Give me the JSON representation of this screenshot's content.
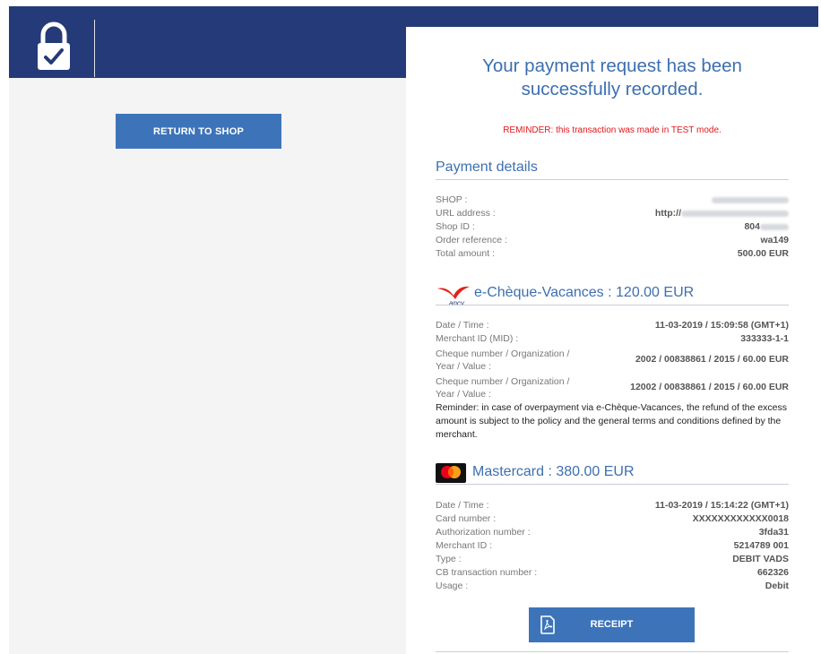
{
  "header": {
    "lock_icon": "lock-check-icon"
  },
  "left": {
    "return_label": "RETURN TO SHOP"
  },
  "confirmation": {
    "headline_line1": "Your payment request has been",
    "headline_line2": "successfully recorded.",
    "reminder": "REMINDER: this transaction was made in TEST mode."
  },
  "payment_details": {
    "title": "Payment details",
    "rows": [
      {
        "label": "SHOP :",
        "value": ""
      },
      {
        "label": "URL address :",
        "value": "http://"
      },
      {
        "label": "Shop ID :",
        "value": "804"
      },
      {
        "label": "Order reference :",
        "value": "wa149"
      },
      {
        "label": "Total amount :",
        "value": "500.00 EUR"
      }
    ]
  },
  "cheque": {
    "title": "e-Chèque-Vacances : 120.00 EUR",
    "logo_text": "ancv",
    "rows": [
      {
        "label": "Date / Time :",
        "value": "11-03-2019 / 15:09:58 (GMT+1)"
      },
      {
        "label": "Merchant ID (MID) :",
        "value": "333333-1-1"
      },
      {
        "label": "Cheque number / Organization / Year / Value :",
        "value": "2002 / 00838861 / 2015 / 60.00 EUR"
      },
      {
        "label": "Cheque number / Organization / Year / Value :",
        "value": "12002 / 00838861 / 2015 / 60.00 EUR"
      }
    ],
    "note": "Reminder: in case of overpayment via e-Chèque-Vacances, the refund of the excess amount is subject to the policy and the general terms and conditions defined by the merchant."
  },
  "mastercard": {
    "title": "Mastercard : 380.00 EUR",
    "logo_icon": "mastercard-logo-icon",
    "colors": {
      "red": "#eb001b",
      "orange": "#f79e1b",
      "yellow": "#ff5f00"
    },
    "rows": [
      {
        "label": "Date / Time :",
        "value": "11-03-2019 / 15:14:22 (GMT+1)"
      },
      {
        "label": "Card number :",
        "value": "XXXXXXXXXXXX0018"
      },
      {
        "label": "Authorization number :",
        "value": "3fda31"
      },
      {
        "label": "Merchant ID :",
        "value": "5214789 001"
      },
      {
        "label": "Type :",
        "value": "DEBIT VADS"
      },
      {
        "label": "CB transaction number :",
        "value": "662326"
      },
      {
        "label": "Usage :",
        "value": "Debit"
      }
    ]
  },
  "receipt": {
    "label": "RECEIPT",
    "icon": "pdf-file-icon"
  },
  "colors": {
    "header_bg": "#253a78",
    "accent": "#3d74b9",
    "title_blue": "#3d6fb0",
    "warning_red": "#e4161a"
  }
}
